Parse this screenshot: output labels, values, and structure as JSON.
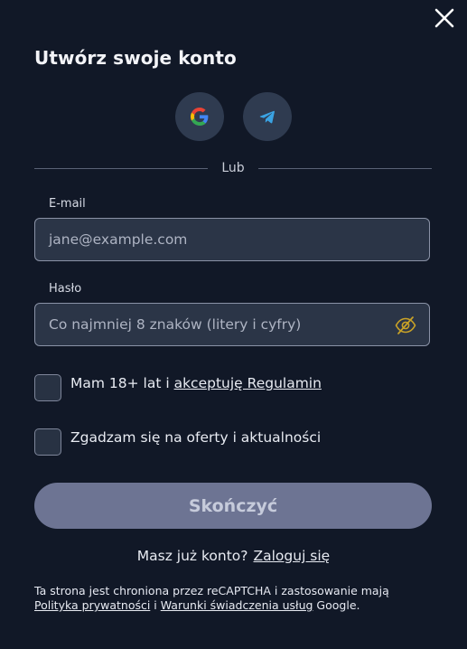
{
  "title": "Utwórz swoje konto",
  "social": {
    "google_icon": "google-g-icon",
    "telegram_icon": "telegram-paper-plane-icon"
  },
  "divider_text": "Lub",
  "email": {
    "label": "E-mail",
    "placeholder": "jane@example.com"
  },
  "password": {
    "label": "Hasło",
    "placeholder": "Co najmniej 8 znaków (litery i cyfry)",
    "toggle_icon": "eye-off-icon"
  },
  "checkboxes": [
    {
      "text": "Mam 18+ lat i ",
      "link": "akceptuję Regulamin",
      "checked": false
    },
    {
      "text": "Zgadzam się na oferty i aktualności",
      "checked": false
    }
  ],
  "submit_label": "Skończyć",
  "login": {
    "question": "Masz już konto?",
    "link": "Zaloguj się"
  },
  "footer": {
    "text1": "Ta strona jest chroniona przez reCAPTCHA i zastosowanie mają ",
    "privacy_link": "Polityka prywatności",
    "and": " i ",
    "terms_link": "Warunki świadczenia usług",
    "text2": " Google."
  },
  "colors": {
    "background": "#111827",
    "input_bg": "#2b3547",
    "submit_bg": "#6d7493",
    "eye_icon": "#c9a227"
  }
}
